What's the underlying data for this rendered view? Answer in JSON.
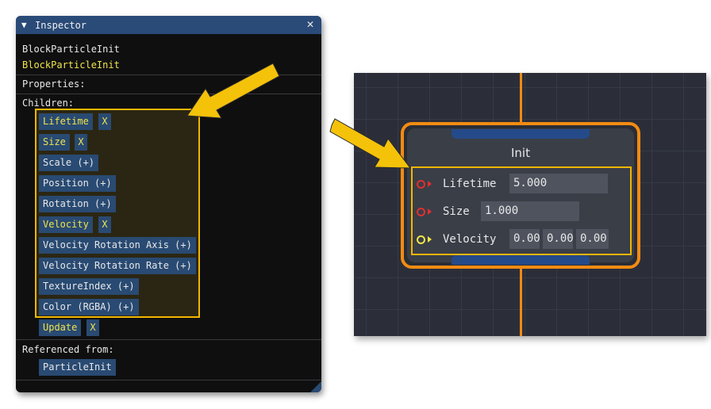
{
  "inspector": {
    "title": "Inspector",
    "object_name": "BlockParticleInit",
    "object_name_highlight": "BlockParticleInit",
    "properties_label": "Properties:",
    "children_label": "Children:",
    "children": [
      {
        "label": "Lifetime",
        "active": true,
        "remove": "X"
      },
      {
        "label": "Size",
        "active": true,
        "remove": "X"
      },
      {
        "label": "Scale (+)",
        "active": false
      },
      {
        "label": "Position (+)",
        "active": false
      },
      {
        "label": "Rotation (+)",
        "active": false
      },
      {
        "label": "Velocity",
        "active": true,
        "remove": "X"
      },
      {
        "label": "Velocity Rotation Axis (+)",
        "active": false
      },
      {
        "label": "Velocity Rotation Rate (+)",
        "active": false
      },
      {
        "label": "TextureIndex (+)",
        "active": false
      },
      {
        "label": "Color (RGBA) (+)",
        "active": false
      },
      {
        "label": "Update",
        "active": true,
        "remove": "X"
      }
    ],
    "referenced_label": "Referenced from:",
    "referenced": [
      {
        "label": "ParticleInit"
      }
    ]
  },
  "node": {
    "title": "Init",
    "pins": [
      {
        "label": "Lifetime",
        "values": [
          "5.000"
        ],
        "color": "#e03030"
      },
      {
        "label": "Size",
        "values": [
          "1.000"
        ],
        "color": "#e03030"
      },
      {
        "label": "Velocity",
        "values": [
          "0.00",
          "0.00",
          "0.00"
        ],
        "color": "#f0e44a"
      }
    ]
  },
  "colors": {
    "highlight": "#f2b600",
    "node_outline": "#f38b12",
    "button_bg": "#294a72",
    "active_text": "#f0e44a",
    "callout_arrow": "#f5c20a"
  },
  "icons": [
    "collapse-triangle-icon",
    "close-icon",
    "resize-grip-icon",
    "callout-arrow-icon",
    "input-pin-icon"
  ]
}
